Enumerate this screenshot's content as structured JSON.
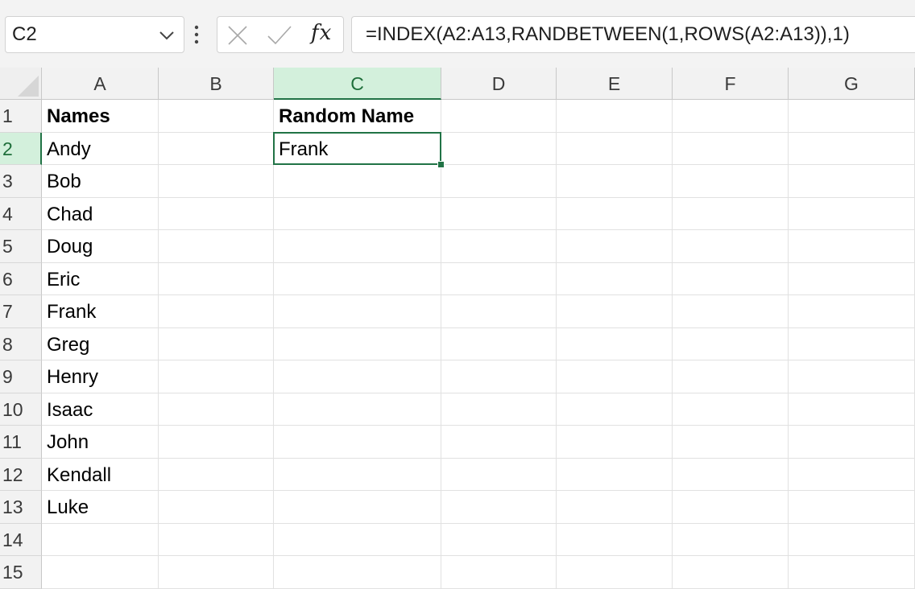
{
  "name_box": {
    "value": "C2"
  },
  "formula_bar": {
    "fx_label": "fx",
    "formula": "=INDEX(A2:A13,RANDBETWEEN(1,ROWS(A2:A13)),1)"
  },
  "sheet": {
    "columns": [
      "A",
      "B",
      "C",
      "D",
      "E",
      "F",
      "G"
    ],
    "rows": [
      "1",
      "2",
      "3",
      "4",
      "5",
      "6",
      "7",
      "8",
      "9",
      "10",
      "11",
      "12",
      "13",
      "14",
      "15"
    ],
    "selected_cell": "C2",
    "cells": {
      "A1": "Names",
      "C1": "Random Name",
      "A2": "Andy",
      "C2": "Frank",
      "A3": "Bob",
      "A4": "Chad",
      "A5": "Doug",
      "A6": "Eric",
      "A7": "Frank",
      "A8": "Greg",
      "A9": "Henry",
      "A10": "Isaac",
      "A11": "John",
      "A12": "Kendall",
      "A13": "Luke"
    },
    "bold_cells": [
      "A1",
      "C1"
    ]
  },
  "colors": {
    "accent": "#217346",
    "header_bg": "#f2f2f2",
    "active_header_bg": "#d3f0dc"
  },
  "icons": [
    "chevron-down-icon",
    "more-options-icon",
    "cancel-icon",
    "enter-icon",
    "insert-function-icon"
  ]
}
